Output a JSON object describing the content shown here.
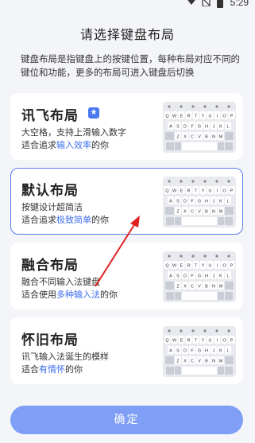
{
  "status": {
    "time": "5:29"
  },
  "page": {
    "title": "请选择键盘布局",
    "description": "键盘布局是指键盘上的按键位置，每种布局对应不同的键位和功能，更多的布局可进入键盘后切换"
  },
  "layouts": [
    {
      "name": "讯飞布局",
      "line1": "大空格，支持上滑输入数字",
      "line2_prefix": "适合追求",
      "line2_highlight": "输入效率",
      "line2_suffix": "的你",
      "badge": "★"
    },
    {
      "name": "默认布局",
      "line1": "按键设计超简洁",
      "line2_prefix": "适合追求",
      "line2_highlight": "极致简单",
      "line2_suffix": "的你",
      "selected": true
    },
    {
      "name": "融合布局",
      "line1": "融合不同输入法键盘",
      "line2_prefix": "适合使用",
      "line2_highlight": "多种输入法",
      "line2_suffix": "的你"
    },
    {
      "name": "怀旧布局",
      "line1": "讯飞输入法诞生的模样",
      "line2_prefix": "适合",
      "line2_highlight": "有情怀",
      "line2_suffix": "的你"
    }
  ],
  "keyboard_preview": {
    "row1": [
      "Q",
      "W",
      "E",
      "R",
      "T",
      "Y",
      "U",
      "I",
      "O",
      "P"
    ],
    "row2": [
      "A",
      "S",
      "D",
      "F",
      "G",
      "H",
      "J",
      "K",
      "L"
    ],
    "row3": [
      "Z",
      "X",
      "C",
      "V",
      "B",
      "N",
      "M"
    ]
  },
  "confirm_button": {
    "label": "确定"
  },
  "colors": {
    "accent": "#4a78f0",
    "highlight": "#3e6ef0",
    "button": "#7f9ef5",
    "arrow": "#e02020"
  }
}
